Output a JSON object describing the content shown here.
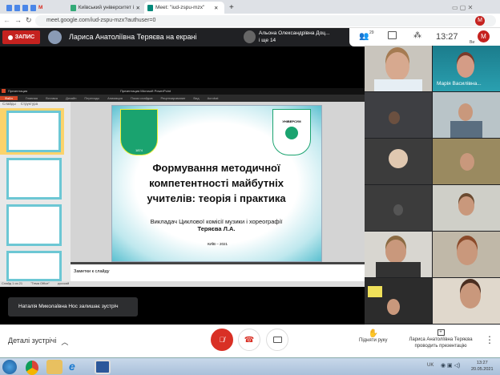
{
  "browser": {
    "tabs": [
      {
        "label": "Київський університет імені Бор"
      },
      {
        "label": "Meet: \"iud-zspu-mzx\""
      }
    ],
    "url": "meet.google.com/iud-zspu-mzx?authuser=0",
    "profile_initial": "M"
  },
  "meet_header": {
    "record_label": "ЗАПИС",
    "presenter_text": "Лариса Анатоліївна Теряєва на екрані",
    "speaker_name": "Альона Олександрівна Доц...",
    "speaker_more": "і ще 14",
    "participants_count": "29",
    "time": "13:27",
    "self_initial": "M",
    "self_label": "Ви"
  },
  "powerpoint": {
    "title_left": "Презентация",
    "title_right": "Презентация Microsoft PowerPoint",
    "ribbon_tabs": [
      "Файл",
      "Главная",
      "Вставка",
      "Дизайн",
      "Переходы",
      "Анимация",
      "Показ слайдов",
      "Рецензирование",
      "Вид",
      "Acrobat"
    ],
    "panel_tabs": [
      "Слайды",
      "Структура"
    ],
    "notes_placeholder": "Заметки к слайду",
    "status": [
      "Слайд 1 из 21",
      "\"Тема Office\"",
      "русский"
    ],
    "slide": {
      "title": "Формування методичної компетентності майбутніх учителів: теорія і практика",
      "subtitle_prefix": "Викладач Циклової комісії музики і хореографії ",
      "subtitle_name": "Теряєва Л.А.",
      "footer": "КИЇВ – 2021",
      "logo_left_year": "1874",
      "logo_right_text": "УНІВЕРСУМ"
    }
  },
  "participants": [
    {
      "name": ""
    },
    {
      "name": "Марія Василівна..."
    }
  ],
  "notification": "Наталія Миколаївна Нос залишає зустріч",
  "bottom_bar": {
    "details_label": "Деталі зустрічі",
    "raise_hand": "Підняти руку",
    "presenting": "Лариса Анатоліївна Теряєва проводить презентацію"
  },
  "taskbar": {
    "lang": "UK",
    "time": "13:27",
    "date": "20.05.2021"
  },
  "colors": {
    "record": "#c5221f",
    "mic_off": "#d93025",
    "slide_frame": "#5bc0d0"
  }
}
